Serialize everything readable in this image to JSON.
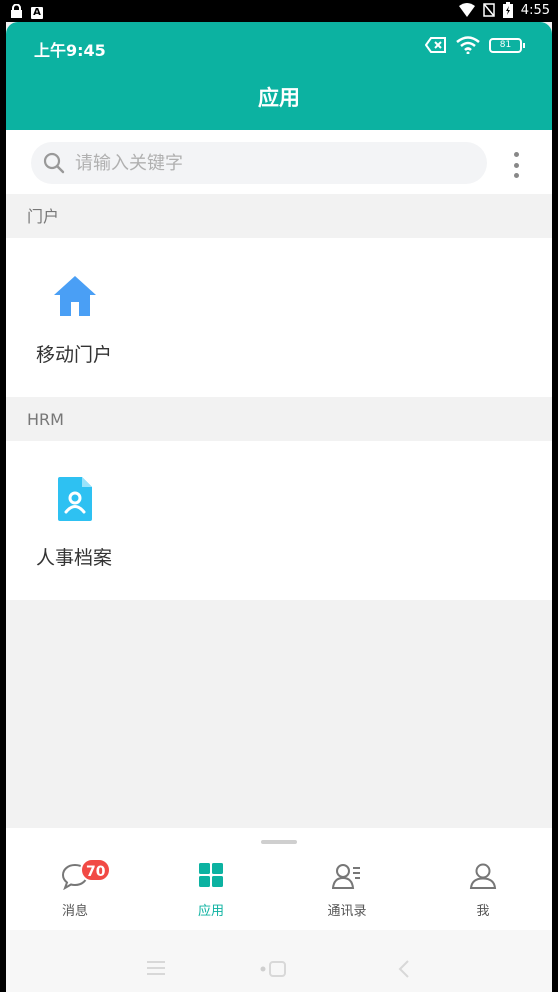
{
  "device_status": {
    "time": "4:55"
  },
  "app_status": {
    "time": "上午9:45",
    "battery": "81"
  },
  "header": {
    "title": "应用"
  },
  "search": {
    "placeholder": "请输入关键字",
    "value": ""
  },
  "sections": [
    {
      "label": "门户",
      "apps": [
        {
          "label": "移动门户",
          "icon": "home-icon"
        }
      ]
    },
    {
      "label": "HRM",
      "apps": [
        {
          "label": "人事档案",
          "icon": "person-file-icon"
        }
      ]
    }
  ],
  "nav": {
    "items": [
      {
        "label": "消息",
        "icon": "chat-bubble-icon",
        "badge": "70"
      },
      {
        "label": "应用",
        "icon": "grid-icon",
        "active": true
      },
      {
        "label": "通讯录",
        "icon": "contacts-icon"
      },
      {
        "label": "我",
        "icon": "user-icon"
      }
    ]
  },
  "colors": {
    "accent": "#0cb2a1",
    "badge": "#f14a45",
    "home_icon": "#4a9ff5",
    "file_icon": "#2ec1f2"
  }
}
